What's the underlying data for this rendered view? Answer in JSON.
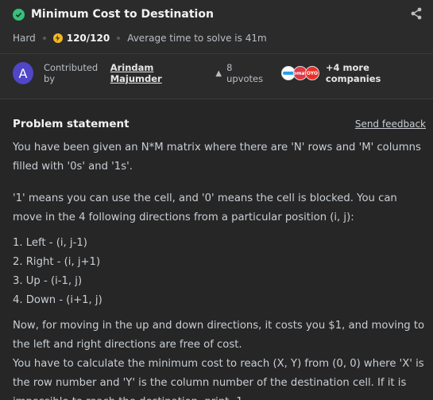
{
  "problem": {
    "title": "Minimum Cost to Destination",
    "difficulty": "Hard",
    "score": "120/120",
    "avg_time": "Average time to solve is 41m"
  },
  "contrib": {
    "avatar_letter": "A",
    "label": "Contributed by",
    "author": "Arindam Majumder",
    "upvotes": "8 upvotes",
    "companies": [
      "Company logo",
      "zomato",
      "OYO"
    ],
    "more": "+4 more companies"
  },
  "statement": {
    "heading": "Problem statement",
    "feedback": "Send feedback",
    "p1": "You have been given an N*M matrix where there are 'N' rows and 'M' columns filled with '0s' and '1s'.",
    "p2": "'1' means you can use the cell, and '0' means the cell is blocked. You can move in the 4 following directions from a particular position (i, j):",
    "dirs": [
      "1. Left - (i, j-1)",
      "2. Right - (i, j+1)",
      "3. Up - (i-1, j)",
      "4. Down - (i+1, j)"
    ],
    "p3": "Now, for moving in the up and down directions, it costs you $1, and moving to the left and right directions are free of cost.",
    "p4": "You have to calculate the minimum cost to reach (X, Y) from (0, 0) where 'X' is the row number and 'Y' is the column number of the destination cell. If it is impossible to reach the destination, print -1."
  },
  "colors": {
    "success": "#33c27a",
    "avatar": "#4f46c8",
    "coin": "#f2b925"
  }
}
